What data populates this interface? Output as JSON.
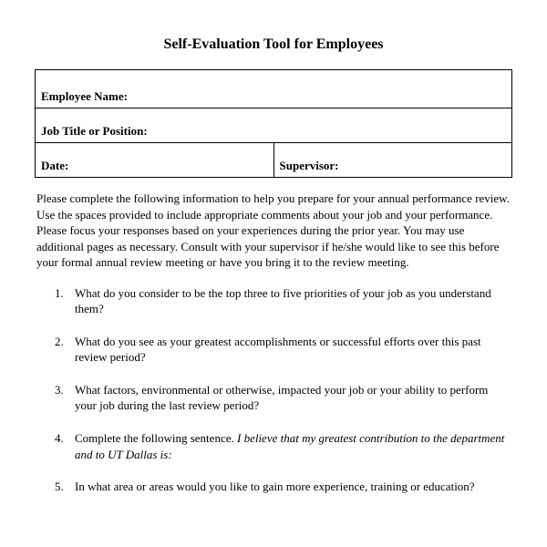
{
  "title": "Self-Evaluation Tool for Employees",
  "fields": {
    "employee_name_label": "Employee Name:",
    "job_title_label": "Job Title or Position:",
    "date_label": "Date:",
    "supervisor_label": "Supervisor:"
  },
  "instructions": "Please complete the following information to help you prepare for your annual performance review.  Use the spaces provided to include appropriate comments about your job and your performance. Please focus your responses based on your experiences during the prior year. You may use additional pages as necessary. Consult with your supervisor if he/she would like to see this before your formal annual review meeting or have you bring it to the review meeting.",
  "questions": [
    "What do you consider to be the top three to five priorities of your job as you understand them?",
    "What do you see as your greatest accomplishments or successful efforts over this past review period?",
    "What factors, environmental or otherwise, impacted your job or your ability to perform your job during the last review period?",
    "",
    "In what area or areas would you like to gain more experience, training or education?"
  ],
  "question4": {
    "prefix": "Complete the following sentence.  ",
    "italic": "I believe that my greatest contribution to the department and to UT Dallas is:"
  }
}
